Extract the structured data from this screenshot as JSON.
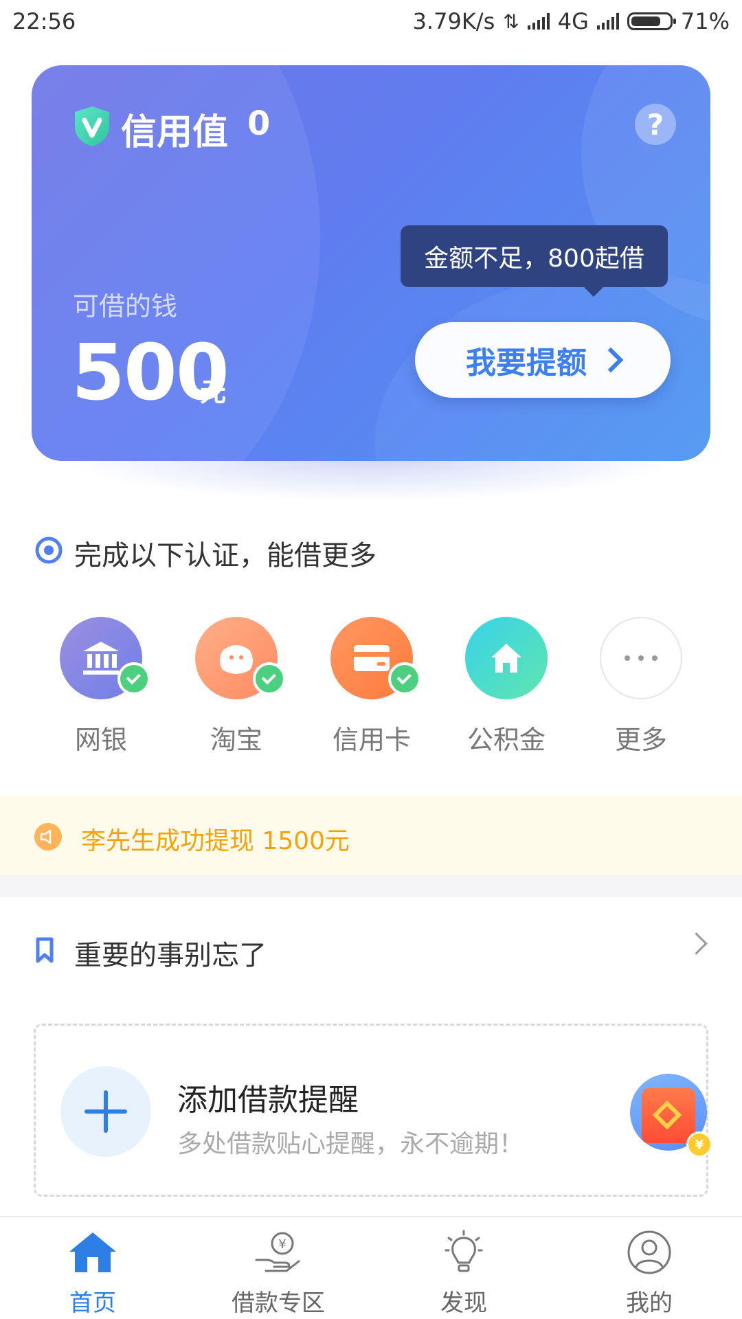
{
  "status_bar": {
    "time": "22:56",
    "network_speed": "3.79K/s",
    "network_type": "4G",
    "battery": "71%"
  },
  "credit_card": {
    "title": "信用值",
    "value": "0",
    "help_icon": "question-icon",
    "borrow_label": "可借的钱",
    "amount": "500",
    "amount_unit": "元",
    "tooltip": "金额不足，800起借",
    "raise_button": "我要提额"
  },
  "verification": {
    "title": "完成以下认证，能借更多",
    "items": [
      {
        "label": "网银",
        "icon": "bank-icon",
        "verified": true,
        "color": "#7d7fe0"
      },
      {
        "label": "淘宝",
        "icon": "taobao-icon",
        "verified": true,
        "color": "#ff9a72"
      },
      {
        "label": "信用卡",
        "icon": "credit-card-icon",
        "verified": true,
        "color": "#ff8a4a"
      },
      {
        "label": "公积金",
        "icon": "house-icon",
        "verified": false,
        "color": "#3ed8d0"
      },
      {
        "label": "更多",
        "icon": "more-icon",
        "verified": false,
        "color": "#ffffff"
      }
    ]
  },
  "notice": {
    "text": "李先生成功提现 1500元",
    "icon": "speaker-icon"
  },
  "reminder": {
    "title": "重要的事别忘了",
    "add_title": "添加借款提醒",
    "add_subtitle": "多处借款贴心提醒，永不逾期！"
  },
  "bottom_nav": {
    "items": [
      {
        "label": "首页",
        "icon": "home-icon",
        "active": true
      },
      {
        "label": "借款专区",
        "icon": "loan-hand-icon",
        "active": false
      },
      {
        "label": "发现",
        "icon": "lightbulb-icon",
        "active": false
      },
      {
        "label": "我的",
        "icon": "user-icon",
        "active": false
      }
    ]
  },
  "colors": {
    "accent": "#2e7fe5",
    "card_gradient_start": "#6f76e8",
    "card_gradient_end": "#4d97f3",
    "notice_text": "#f3a10d",
    "check_green": "#4cd080"
  }
}
